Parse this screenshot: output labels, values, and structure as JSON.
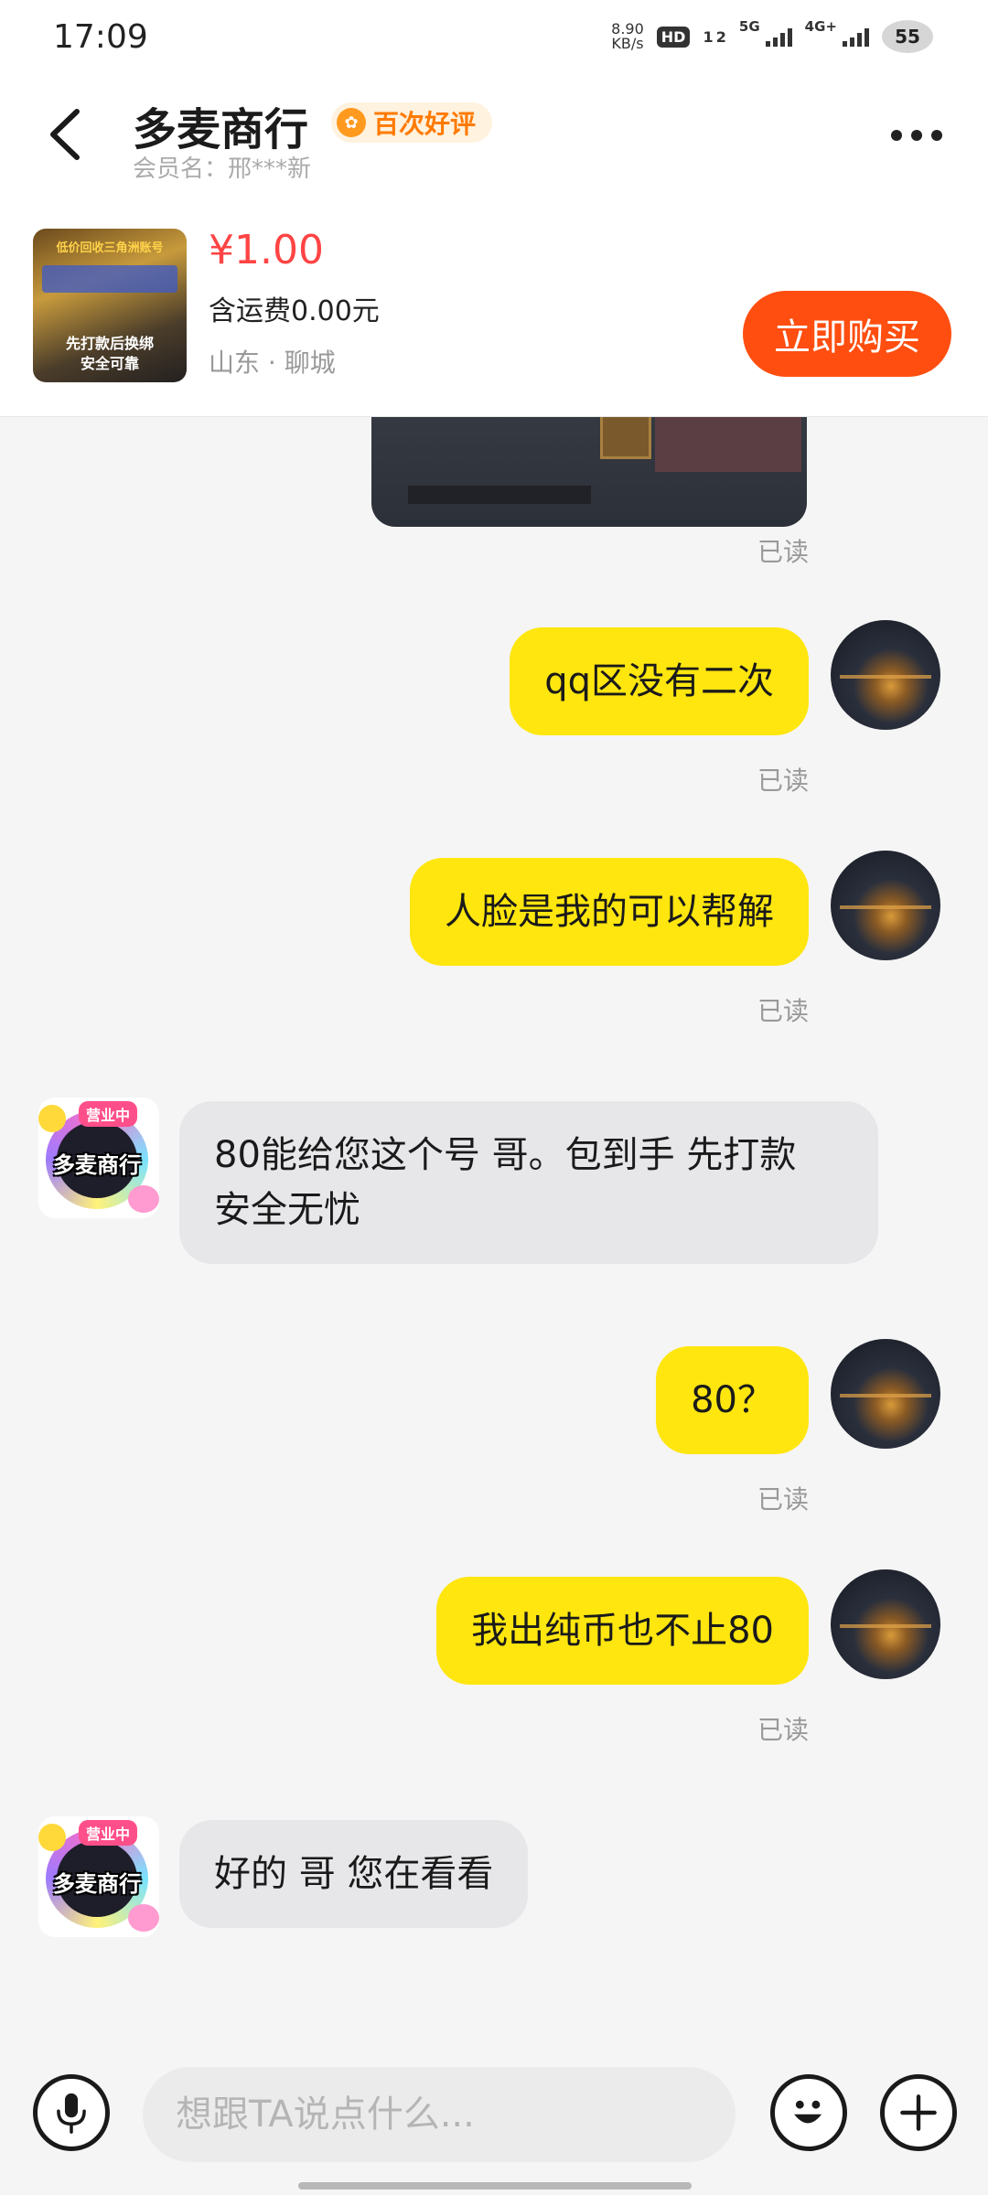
{
  "status_bar": {
    "time": "17:09",
    "net_speed_value": "8.90",
    "net_speed_unit": "KB/s",
    "hd_badge": "HD",
    "sim": "1 2",
    "signal1_label": "5G",
    "signal2_label": "4G+",
    "battery": "55"
  },
  "header": {
    "shop_name": "多麦商行",
    "badge": "百次好评",
    "member_label": "会员名：邢***新"
  },
  "product": {
    "image_text_top": "低价回收三角洲账号",
    "image_text_mid1": "先打款后换绑",
    "image_text_mid2": "安全可靠",
    "price": "¥1.00",
    "shipping": "含运费0.00元",
    "location": "山东 · 聊城",
    "buy_label": "立即购买"
  },
  "messages": [
    {
      "from": "me",
      "type": "image",
      "read": "已读"
    },
    {
      "from": "me",
      "text": "qq区没有二次",
      "read": "已读"
    },
    {
      "from": "me",
      "text": "人脸是我的可以帮解",
      "read": "已读"
    },
    {
      "from": "shop",
      "text": "80能给您这个号 哥。包到手 先打款 安全无忧"
    },
    {
      "from": "me",
      "text": "80？",
      "read": "已读"
    },
    {
      "from": "me",
      "text": "我出纯币也不止80",
      "read": "已读"
    },
    {
      "from": "shop",
      "text": "好的 哥 您在看看"
    }
  ],
  "shop_avatar": {
    "label": "多麦商行",
    "tag": "营业中"
  },
  "input": {
    "placeholder": "想跟TA说点什么..."
  },
  "colors": {
    "my_bubble": "#ffe60f",
    "buy_button": "#ff4e10",
    "price": "#ff4444",
    "badge_text": "#ff7a00"
  },
  "icons": [
    "back-arrow-icon",
    "more-dots-icon",
    "medal-icon",
    "microphone-icon",
    "emoji-icon",
    "plus-icon"
  ]
}
